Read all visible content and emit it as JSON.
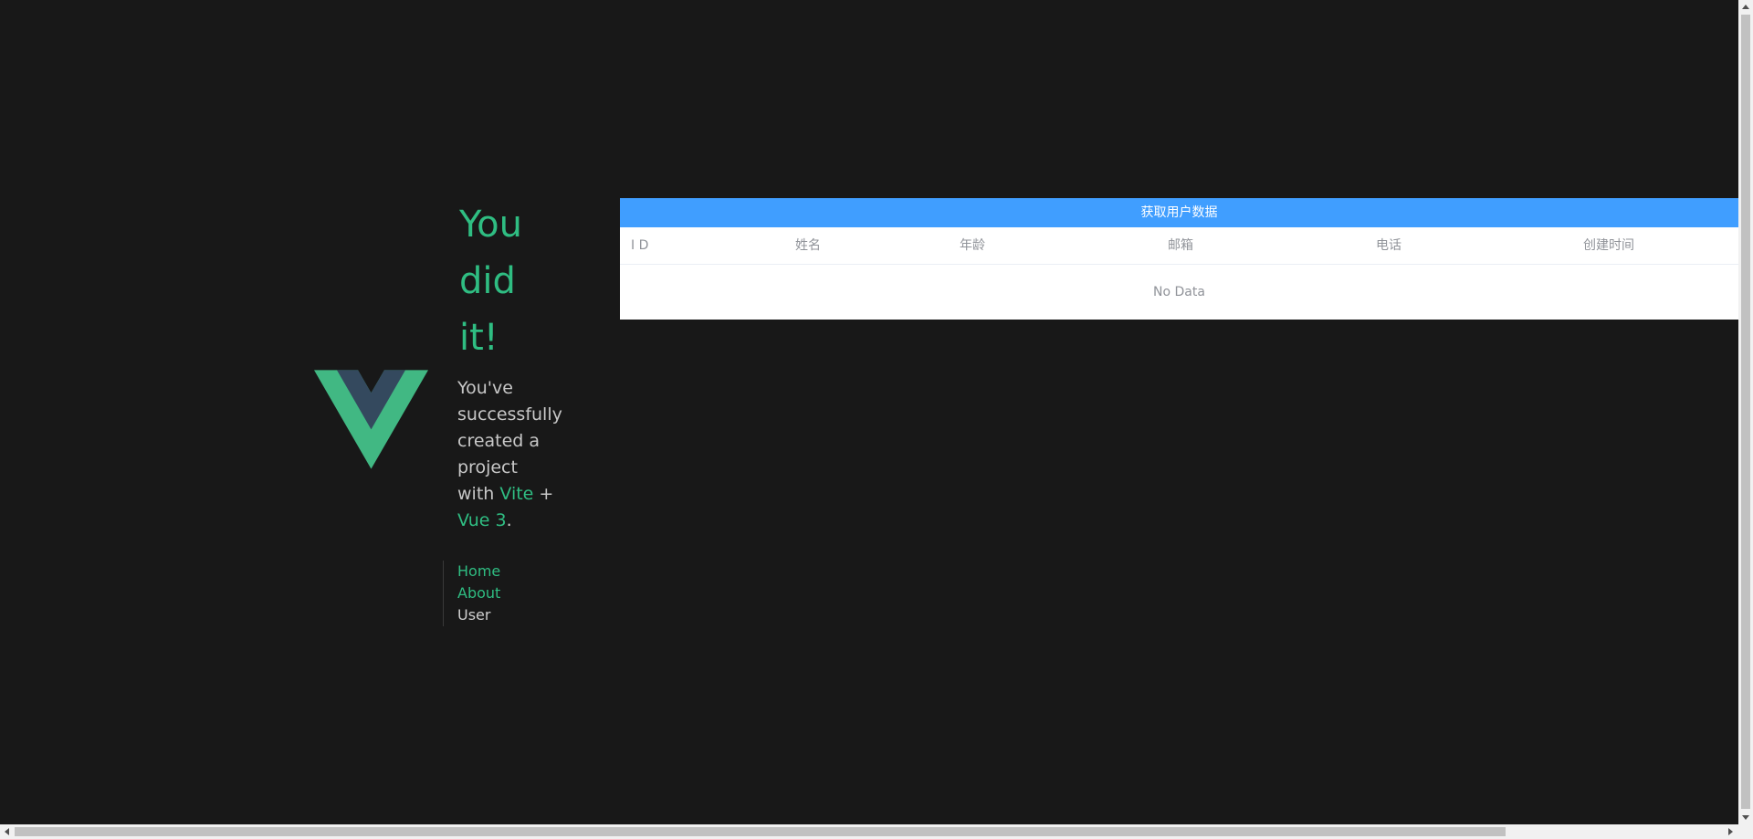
{
  "hero": {
    "heading_lines": [
      "You",
      "did",
      "it!"
    ],
    "subtitle": {
      "prefix": "You've successfully created a project with",
      "link_vite": "Vite",
      "plus": "+",
      "link_vue": "Vue 3",
      "suffix": "."
    }
  },
  "nav": {
    "items": [
      {
        "label": "Home",
        "active": false
      },
      {
        "label": "About",
        "active": false
      },
      {
        "label": "User",
        "active": true
      }
    ]
  },
  "users_panel": {
    "fetch_button_label": "获取用户数据",
    "columns": [
      "I D",
      "姓名",
      "年龄",
      "邮箱",
      "电话",
      "创建时间"
    ],
    "rows": [],
    "empty_text": "No Data"
  },
  "colors": {
    "background": "#181818",
    "accent_green": "#2fbd82",
    "button_blue": "#409eff",
    "muted_text": "#909399"
  }
}
